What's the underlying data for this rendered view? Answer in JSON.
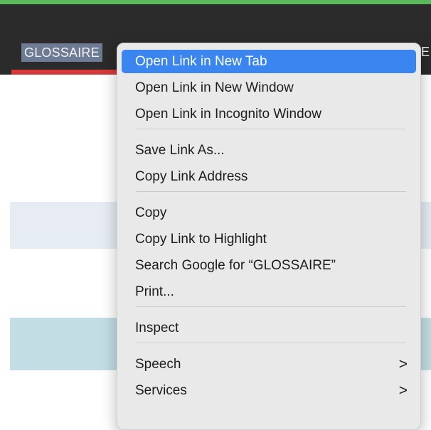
{
  "navbar": {
    "link_label": "GLOSSAIRE",
    "trailing_fragment": "E"
  },
  "context_menu": {
    "group1": [
      {
        "label": "Open Link in New Tab"
      },
      {
        "label": "Open Link in New Window"
      },
      {
        "label": "Open Link in Incognito Window"
      }
    ],
    "group2": [
      {
        "label": "Save Link As..."
      },
      {
        "label": "Copy Link Address"
      }
    ],
    "group3": [
      {
        "label": "Copy"
      },
      {
        "label": "Copy Link to Highlight"
      },
      {
        "label": "Search Google for “GLOSSAIRE”"
      },
      {
        "label": "Print..."
      }
    ],
    "group4": [
      {
        "label": "Inspect"
      }
    ],
    "group5": [
      {
        "label": "Speech",
        "submenu_indicator": ">"
      },
      {
        "label": "Services",
        "submenu_indicator": ">"
      }
    ]
  },
  "colors": {
    "top_accent": "#5cb85c",
    "navbar_bg": "#2b2b2b",
    "nav_underline": "#d43a3a",
    "link_selection": "#6d7b94",
    "menu_highlight": "#3a85ef",
    "band_1": "#e6ebf4",
    "band_2": "#c2dee4"
  }
}
